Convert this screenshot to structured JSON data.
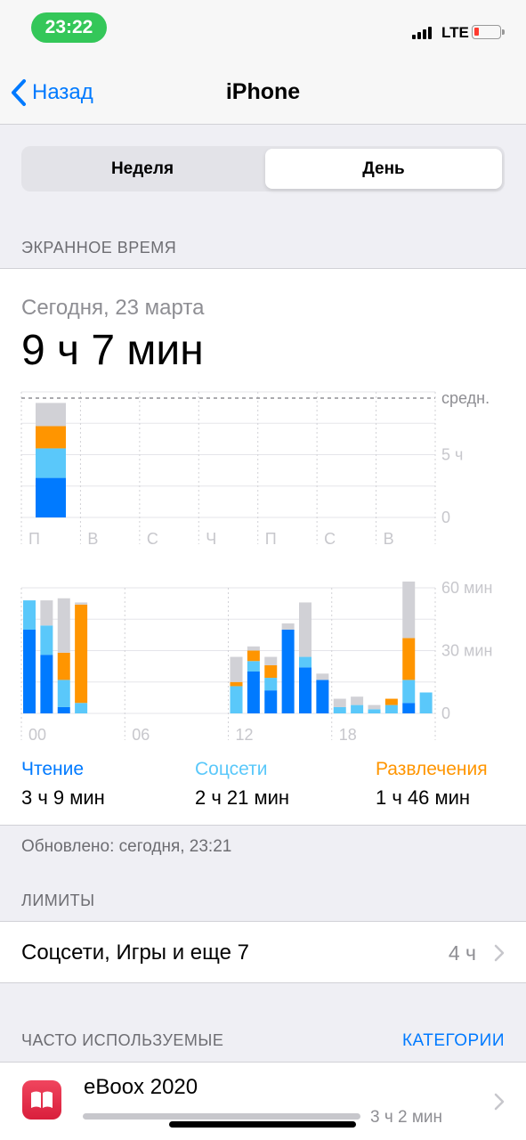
{
  "status_bar": {
    "time": "23:22",
    "network": "LTE"
  },
  "nav": {
    "back_label": "Назад",
    "title": "iPhone"
  },
  "segmented": {
    "options": [
      "Неделя",
      "День"
    ],
    "selected": "День"
  },
  "screen_time": {
    "section_header": "ЭКРАННОЕ ВРЕМЯ",
    "date": "Сегодня, 23 марта",
    "total": "9 ч 7 мин"
  },
  "chart_data": [
    {
      "type": "bar",
      "stacked": true,
      "categories": [
        "П",
        "В",
        "С",
        "Ч",
        "П",
        "С",
        "В"
      ],
      "series": [
        {
          "name": "Чтение",
          "values": [
            3.15,
            0,
            0,
            0,
            0,
            0,
            0
          ]
        },
        {
          "name": "Соцсети",
          "values": [
            2.35,
            0,
            0,
            0,
            0,
            0,
            0
          ]
        },
        {
          "name": "Развлечения",
          "values": [
            1.77,
            0,
            0,
            0,
            0,
            0,
            0
          ]
        },
        {
          "name": "",
          "values": [
            1.85,
            0,
            0,
            0,
            0,
            0,
            0
          ]
        }
      ],
      "y_ticks": [
        "0",
        "5 ч"
      ],
      "average_label": "средн.",
      "average_value": 9.5,
      "ylim": [
        0,
        10
      ],
      "grid": true
    },
    {
      "type": "bar",
      "stacked": true,
      "x_ticks": [
        "00",
        "06",
        "12",
        "18"
      ],
      "series": [
        {
          "name": "Чтение",
          "values": [
            40,
            28,
            3,
            0,
            0,
            0,
            0,
            0,
            0,
            0,
            0,
            0,
            0,
            20,
            11,
            40,
            22,
            16,
            0,
            0,
            0,
            0,
            5,
            0
          ]
        },
        {
          "name": "Соцсети",
          "values": [
            14,
            14,
            13,
            5,
            0,
            0,
            0,
            0,
            0,
            0,
            0,
            0,
            13,
            5,
            6,
            0,
            5,
            0,
            3,
            4,
            2,
            4,
            11,
            10
          ]
        },
        {
          "name": "Развлечения",
          "values": [
            0,
            0,
            13,
            47,
            0,
            0,
            0,
            0,
            0,
            0,
            0,
            0,
            2,
            5,
            6,
            0,
            0,
            0,
            0,
            0,
            0,
            3,
            20,
            0
          ]
        },
        {
          "name": "",
          "values": [
            0,
            12,
            26,
            1,
            0,
            0,
            0,
            0,
            0,
            0,
            0,
            0,
            12,
            2,
            4,
            3,
            26,
            3,
            4,
            4,
            2,
            0,
            27,
            0
          ]
        }
      ],
      "y_ticks": [
        "0",
        "30 мин",
        "60 мин"
      ],
      "ylim": [
        0,
        60
      ],
      "grid": true
    }
  ],
  "categories": [
    {
      "name": "Чтение",
      "time": "3 ч 9 мин",
      "color": "#007aff"
    },
    {
      "name": "Соцсети",
      "time": "2 ч 21 мин",
      "color": "#5ac8fa"
    },
    {
      "name": "Развлечения",
      "time": "1 ч 46 мин",
      "color": "#ff9500"
    }
  ],
  "other_color": "#d1d1d6",
  "updated": "Обновлено: сегодня, 23:21",
  "limits": {
    "section_header": "ЛИМИТЫ",
    "row_label": "Соцсети, Игры и еще 7",
    "row_value": "4 ч"
  },
  "most_used": {
    "section_header": "ЧАСТО ИСПОЛЬЗУЕМЫЕ",
    "action": "КАТЕГОРИИ",
    "apps": [
      {
        "name": "eBoox 2020",
        "time": "3 ч 2 мин",
        "icon": "book-icon"
      }
    ]
  }
}
